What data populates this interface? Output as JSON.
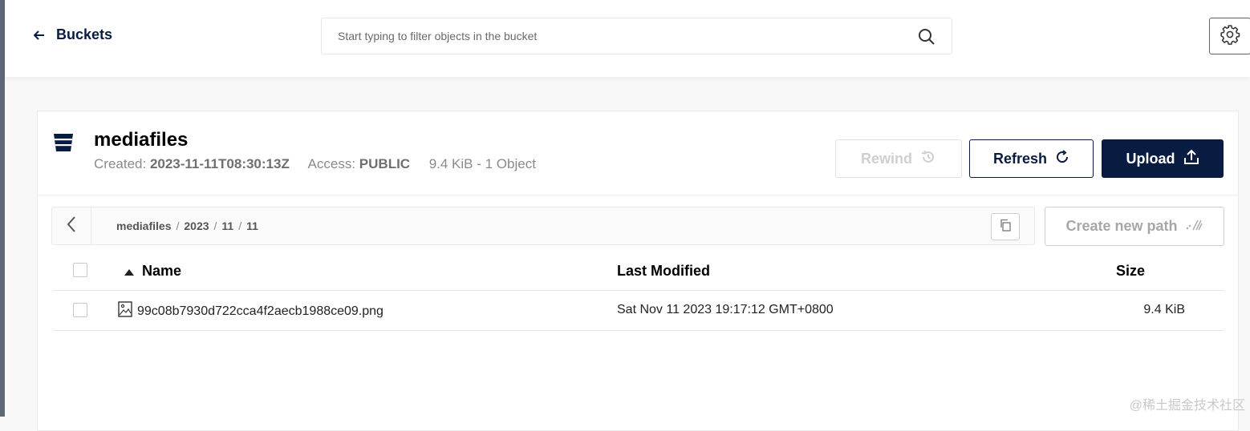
{
  "header": {
    "back_label": "Buckets",
    "search_placeholder": "Start typing to filter objects in the bucket"
  },
  "bucket": {
    "name": "mediafiles",
    "created_label": "Created:",
    "created_value": "2023-11-11T08:30:13Z",
    "access_label": "Access:",
    "access_value": "PUBLIC",
    "summary": "9.4 KiB - 1 Object"
  },
  "actions": {
    "rewind": "Rewind",
    "refresh": "Refresh",
    "upload": "Upload",
    "create_path": "Create new path"
  },
  "breadcrumb": [
    "mediafiles",
    "2023",
    "11",
    "11"
  ],
  "table": {
    "columns": {
      "name": "Name",
      "modified": "Last Modified",
      "size": "Size"
    },
    "rows": [
      {
        "name": "99c08b7930d722cca4f2aecb1988ce09.png",
        "modified": "Sat Nov 11 2023 19:17:12 GMT+0800",
        "size": "9.4 KiB"
      }
    ]
  },
  "watermark": "@稀土掘金技术社区"
}
